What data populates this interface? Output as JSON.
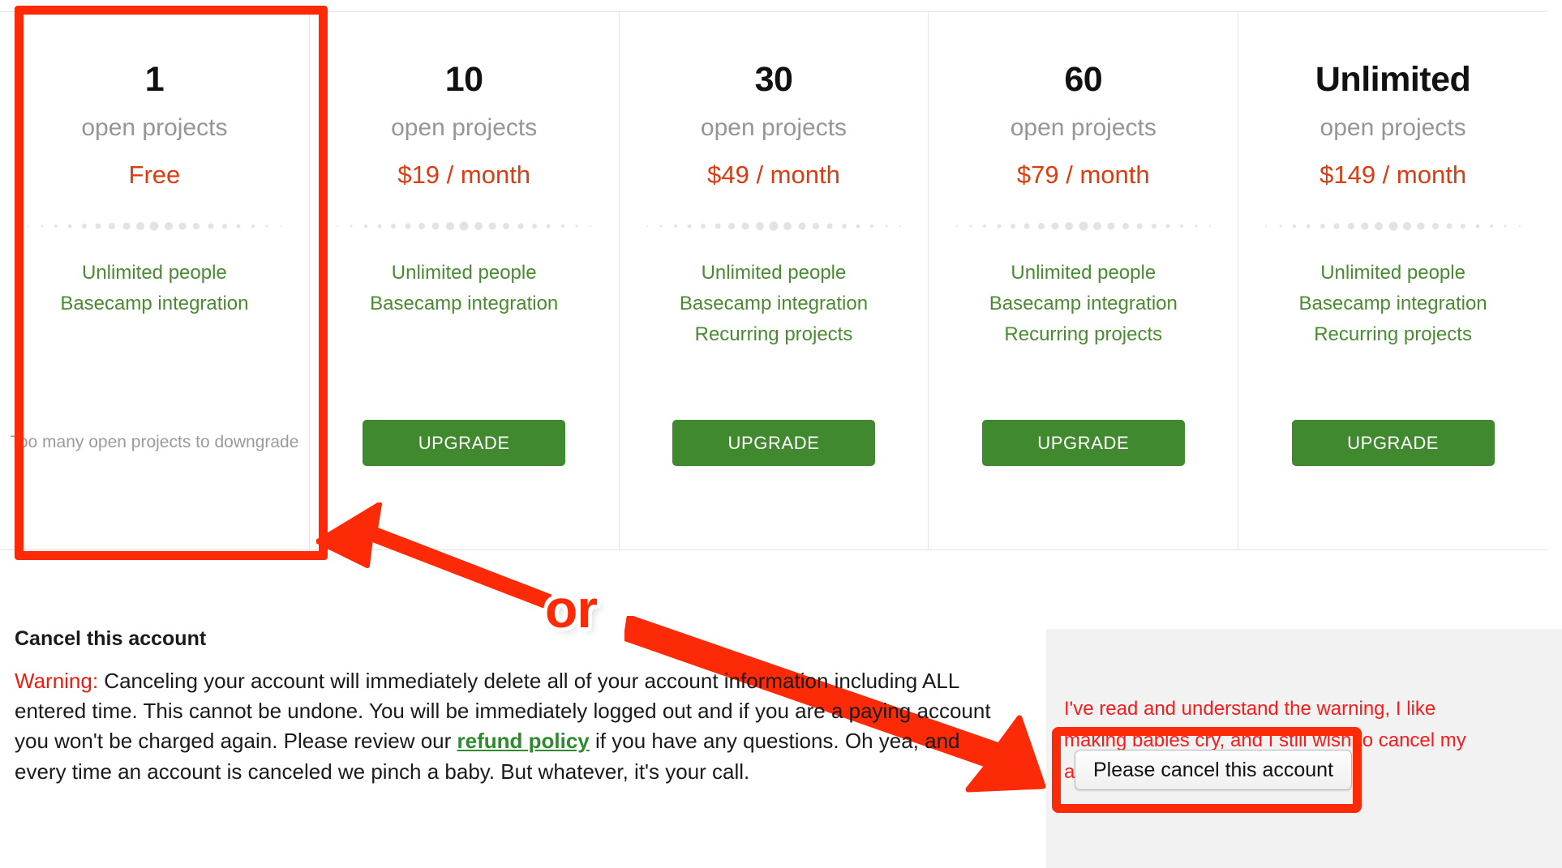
{
  "pricing": {
    "unit_label": "open projects",
    "upgrade_label": "UPGRADE",
    "downgrade_note": "Too many open projects\nto downgrade",
    "accent_price_color": "#dd3c10",
    "feature_color": "#4a8b31",
    "upgrade_button_color": "#40892f",
    "plans": [
      {
        "count": "1",
        "unit": "open projects",
        "price": "Free",
        "features": [
          "Unlimited people",
          "Basecamp integration"
        ],
        "action": "Too many open projects to downgrade",
        "highlighted": true
      },
      {
        "count": "10",
        "unit": "open projects",
        "price": "$19 / month",
        "features": [
          "Unlimited people",
          "Basecamp integration"
        ],
        "action": "UPGRADE",
        "highlighted": false
      },
      {
        "count": "30",
        "unit": "open projects",
        "price": "$49 / month",
        "features": [
          "Unlimited people",
          "Basecamp integration",
          "Recurring projects"
        ],
        "action": "UPGRADE",
        "highlighted": false
      },
      {
        "count": "60",
        "unit": "open projects",
        "price": "$79 / month",
        "features": [
          "Unlimited people",
          "Basecamp integration",
          "Recurring projects"
        ],
        "action": "UPGRADE",
        "highlighted": false
      },
      {
        "count": "Unlimited",
        "unit": "open projects",
        "price": "$149 / month",
        "features": [
          "Unlimited people",
          "Basecamp integration",
          "Recurring projects"
        ],
        "action": "UPGRADE",
        "highlighted": false
      }
    ]
  },
  "annotations": {
    "or_label": "or",
    "highlight_color": "#fc2a06",
    "arrow_color": "#fc2a06"
  },
  "cancel": {
    "heading": "Cancel this account",
    "warning_label": "Warning:",
    "warning_body_part1": " Canceling your account will immediately delete all of your account information including ALL entered time. This cannot be undone. You will be immediately logged out and if you are a paying account you won't be charged again. Please review our ",
    "refund_link": "refund policy",
    "warning_body_part2": " if you have any questions. Oh yea, and every time an account is canceled we pinch a baby. But whatever, it's your call.",
    "confirm_text": "I've read and understand the warning, I like making babies cry, and I still wish to cancel my account.",
    "confirm_button": "Please cancel this account",
    "warning_color": "#f31a0c",
    "confirm_text_color": "#ff1a1a",
    "refund_link_color": "#2d8a2d"
  }
}
